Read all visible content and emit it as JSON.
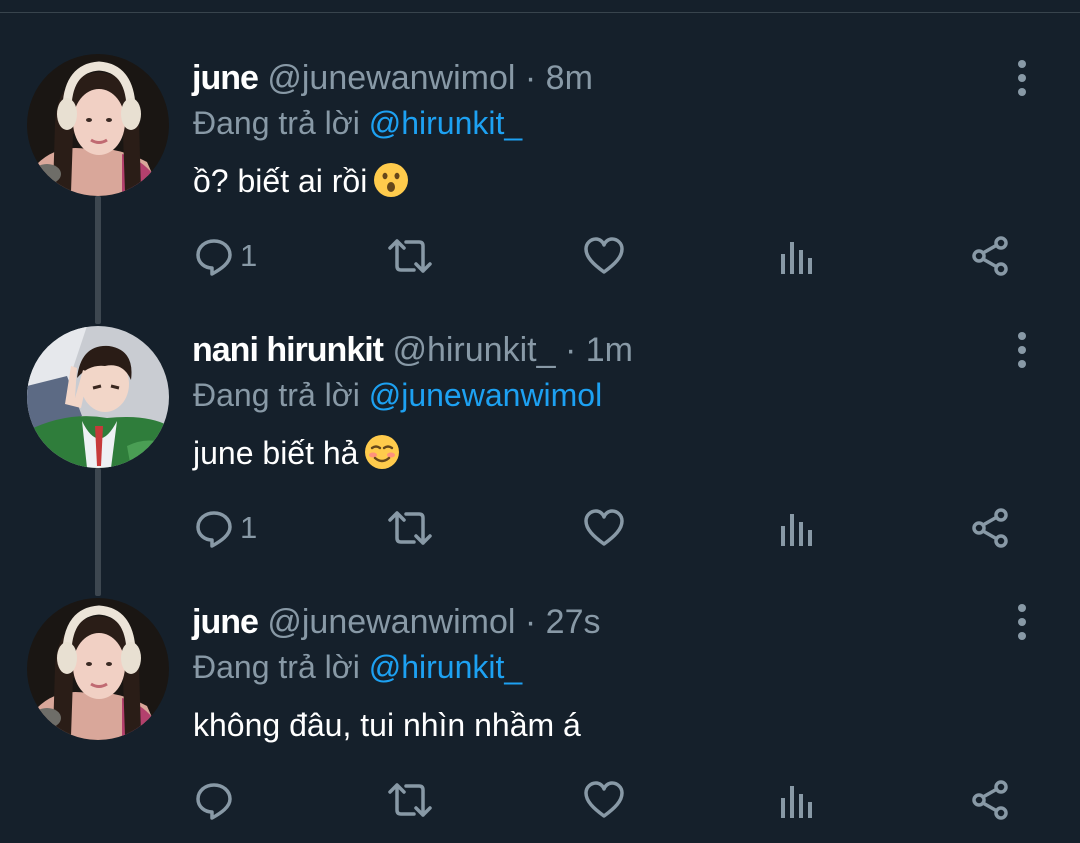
{
  "colors": {
    "background": "#15202b",
    "text_primary": "#ffffff",
    "text_secondary": "#8899a6",
    "accent": "#1da1f2",
    "thread_line": "#3d4750"
  },
  "tweets": [
    {
      "display_name": "june",
      "handle": "@junewanwimol",
      "separator": "·",
      "time": "8m",
      "reply_prefix": "Đang trả lời",
      "reply_to": "@hirunkit_",
      "text": "ồ? biết ai rồi",
      "emoji": "surprised-face-emoji",
      "reply_count": "1"
    },
    {
      "display_name": "nani hirunkit",
      "handle": "@hirunkit_",
      "separator": "·",
      "time": "1m",
      "reply_prefix": "Đang trả lời",
      "reply_to": "@junewanwimol",
      "text": "june biết hả",
      "emoji": "smiling-face-emoji",
      "reply_count": "1"
    },
    {
      "display_name": "june",
      "handle": "@junewanwimol",
      "separator": "·",
      "time": "27s",
      "reply_prefix": "Đang trả lời",
      "reply_to": "@hirunkit_",
      "text": "không đâu, tui nhìn nhầm á",
      "emoji": "",
      "reply_count": ""
    }
  ],
  "icons": {
    "reply": "reply-icon",
    "retweet": "retweet-icon",
    "like": "heart-icon",
    "analytics": "analytics-icon",
    "share": "share-icon",
    "more": "more-vertical-icon"
  }
}
